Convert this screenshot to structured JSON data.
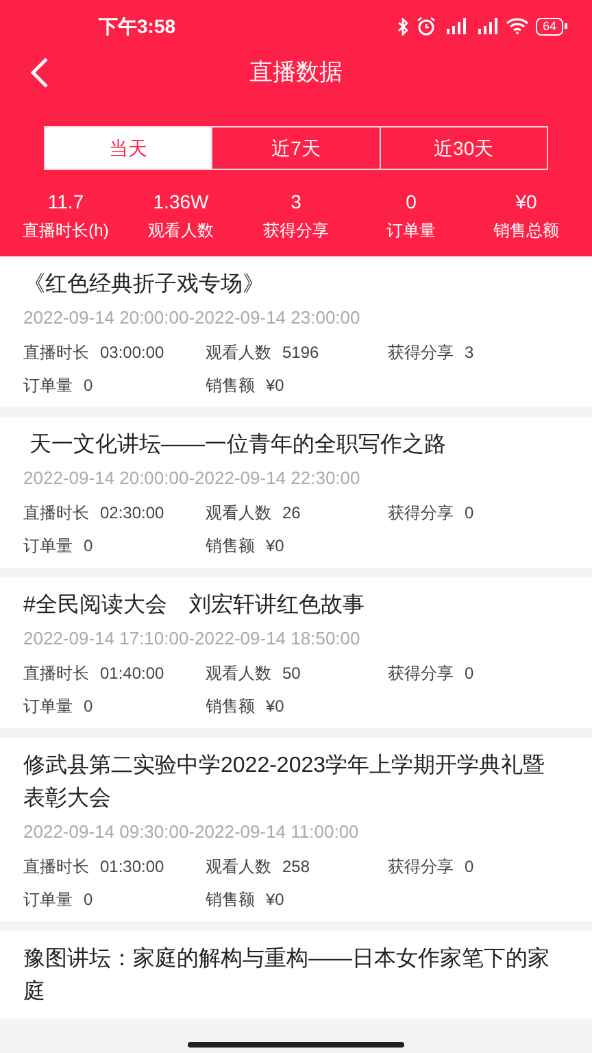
{
  "status_bar": {
    "time": "下午3:58",
    "battery": "64"
  },
  "header": {
    "title": "直播数据"
  },
  "tabs": [
    {
      "label": "当天",
      "selected": true
    },
    {
      "label": "近7天",
      "selected": false
    },
    {
      "label": "近30天",
      "selected": false
    }
  ],
  "summary": [
    {
      "value": "11.7",
      "label": "直播时长(h)"
    },
    {
      "value": "1.36W",
      "label": "观看人数"
    },
    {
      "value": "3",
      "label": "获得分享"
    },
    {
      "value": "0",
      "label": "订单量"
    },
    {
      "value": "¥0",
      "label": "销售总额"
    }
  ],
  "sessions": [
    {
      "title": "《红色经典折子戏专场》",
      "time_range": "2022-09-14 20:00:00-2022-09-14 23:00:00",
      "stats": [
        {
          "label": "直播时长",
          "value": "03:00:00"
        },
        {
          "label": "观看人数",
          "value": "5196"
        },
        {
          "label": "获得分享",
          "value": "3"
        },
        {
          "label": "订单量",
          "value": "0"
        },
        {
          "label": "销售额",
          "value": "¥0"
        }
      ]
    },
    {
      "title": " 天一文化讲坛——一位青年的全职写作之路",
      "time_range": "2022-09-14 20:00:00-2022-09-14 22:30:00",
      "stats": [
        {
          "label": "直播时长",
          "value": "02:30:00"
        },
        {
          "label": "观看人数",
          "value": "26"
        },
        {
          "label": "获得分享",
          "value": "0"
        },
        {
          "label": "订单量",
          "value": "0"
        },
        {
          "label": "销售额",
          "value": "¥0"
        }
      ]
    },
    {
      "title": "#全民阅读大会　刘宏轩讲红色故事",
      "time_range": "2022-09-14 17:10:00-2022-09-14 18:50:00",
      "stats": [
        {
          "label": "直播时长",
          "value": "01:40:00"
        },
        {
          "label": "观看人数",
          "value": "50"
        },
        {
          "label": "获得分享",
          "value": "0"
        },
        {
          "label": "订单量",
          "value": "0"
        },
        {
          "label": "销售额",
          "value": "¥0"
        }
      ]
    },
    {
      "title": "修武县第二实验中学2022-2023学年上学期开学典礼暨表彰大会",
      "time_range": "2022-09-14 09:30:00-2022-09-14 11:00:00",
      "stats": [
        {
          "label": "直播时长",
          "value": "01:30:00"
        },
        {
          "label": "观看人数",
          "value": "258"
        },
        {
          "label": "获得分享",
          "value": "0"
        },
        {
          "label": "订单量",
          "value": "0"
        },
        {
          "label": "销售额",
          "value": "¥0"
        }
      ]
    },
    {
      "title": "豫图讲坛：家庭的解构与重构——日本女作家笔下的家庭"
    }
  ]
}
